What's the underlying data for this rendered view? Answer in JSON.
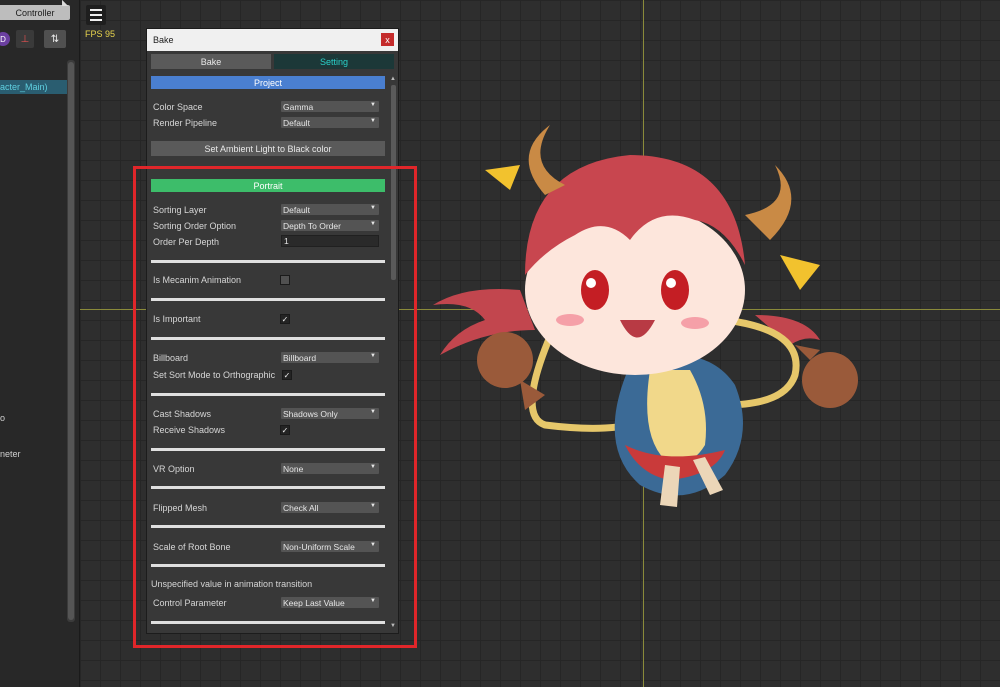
{
  "left_panel": {
    "controller_tab": "Controller",
    "tab_corner_glyph": "◣",
    "icons": [
      "dot-circle-icon",
      "pin-icon",
      "sort-arrows-icon"
    ],
    "icon_glyphs": {
      "purple": "D",
      "red": "⊥",
      "sort": "⇅"
    },
    "selected_item": "acter_Main)",
    "partial_items": [
      "o",
      "neter"
    ]
  },
  "toolbar": {
    "menu_icon": "hamburger-menu-icon",
    "fps": "FPS 95"
  },
  "bake_window": {
    "title": "Bake",
    "close_glyph": "x",
    "tabs": [
      {
        "label": "Bake",
        "active": false
      },
      {
        "label": "Setting",
        "active": true
      }
    ],
    "scroll_up_glyph": "▲",
    "scroll_down_glyph": "▼",
    "project_header": "Project",
    "project_header_color": "#4a7fd0",
    "color_space": {
      "label": "Color Space",
      "value": "Gamma"
    },
    "render_pipeline": {
      "label": "Render Pipeline",
      "value": "Default"
    },
    "ambient_button": "Set Ambient Light to Black color",
    "portrait_header": "Portrait",
    "portrait_header_color": "#3dbd6a",
    "sorting_layer": {
      "label": "Sorting Layer",
      "value": "Default"
    },
    "sorting_order_option": {
      "label": "Sorting Order Option",
      "value": "Depth To Order"
    },
    "order_per_depth": {
      "label": "Order Per Depth",
      "value": "1"
    },
    "is_mecanim": {
      "label": "Is Mecanim Animation",
      "checked": false,
      "mark": ""
    },
    "is_important": {
      "label": "Is Important",
      "checked": true,
      "mark": "✓"
    },
    "billboard": {
      "label": "Billboard",
      "value": "Billboard"
    },
    "sort_mode_ortho": {
      "label": "Set Sort Mode to Orthographic",
      "checked": true,
      "mark": "✓"
    },
    "cast_shadows": {
      "label": "Cast Shadows",
      "value": "Shadows Only"
    },
    "receive_shadows": {
      "label": "Receive Shadows",
      "checked": true,
      "mark": "✓"
    },
    "vr_option": {
      "label": "VR Option",
      "value": "None"
    },
    "flipped_mesh": {
      "label": "Flipped Mesh",
      "value": "Check All"
    },
    "scale_root_bone": {
      "label": "Scale of Root Bone",
      "value": "Non-Uniform Scale"
    },
    "unspecified_note": "Unspecified value in animation transition",
    "control_parameter": {
      "label": "Control Parameter",
      "value": "Keep Last Value"
    },
    "dropdown_arrow": "▼"
  },
  "colors": {
    "accent_setting_tab": "#2ad0c8",
    "highlight_box": "#e0262a",
    "guide_lines": "#8a8a3a",
    "fps_text": "#e8d44d"
  }
}
